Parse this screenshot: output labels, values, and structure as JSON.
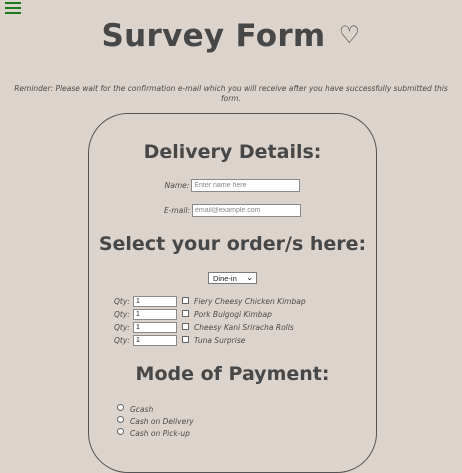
{
  "header": {
    "title": "Survey Form",
    "heart_glyph": "♡",
    "menu_icon": "hamburger-menu-icon",
    "reminder": "Reminder: Please wait for the confirmation e-mail which you will receive after you have successfully submitted this form."
  },
  "delivery": {
    "title": "Delivery Details:",
    "name_label": "Name:",
    "name_placeholder": "Enter name here",
    "email_label": "E-mail:",
    "email_placeholder": "email@example.com"
  },
  "order": {
    "title": "Select your order/s here:",
    "dining_option": "Dine-in",
    "qty_label": "Qty:",
    "items": [
      {
        "name": "Fiery Cheesy Chicken Kimbap",
        "qty": "1"
      },
      {
        "name": "Pork Bulgogi Kimbap",
        "qty": "1"
      },
      {
        "name": "Cheesy Kani Sriracha Rolls",
        "qty": "1"
      },
      {
        "name": "Tuna Surprise",
        "qty": "1"
      }
    ]
  },
  "payment": {
    "title": "Mode of Payment:",
    "options": [
      "Gcash",
      "Cash on Delivery",
      "Cash on Pick-up"
    ]
  },
  "colors": {
    "background": "#dcd3cc",
    "menu_icon": "#1c7a1c",
    "heading": "#474747"
  }
}
